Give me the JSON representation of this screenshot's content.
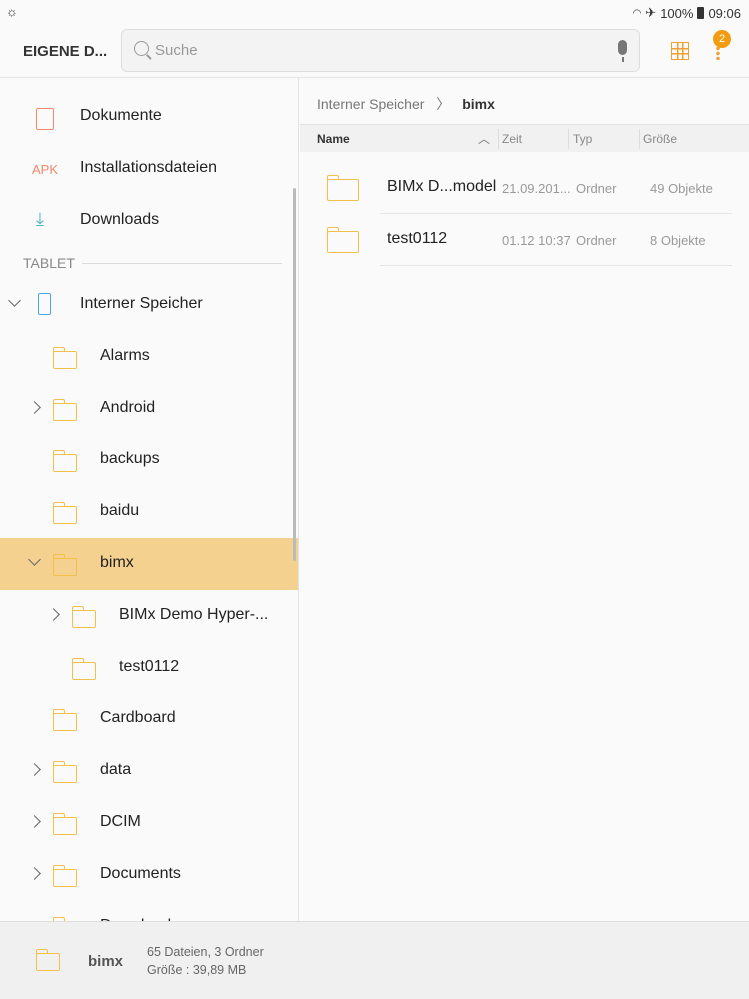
{
  "status": {
    "left_icon": "sync-icon",
    "battery": "100%",
    "time": "09:06",
    "icons": [
      "wifi-icon",
      "airplane-icon",
      "battery-icon"
    ]
  },
  "appbar": {
    "title": "EIGENE D...",
    "search_placeholder": "Suche",
    "badge": "2"
  },
  "sidebar": {
    "top": [
      {
        "icon": "document-icon",
        "label": "Dokumente"
      },
      {
        "icon": "apk-icon",
        "icon_text": "APK",
        "label": "Installationsdateien"
      },
      {
        "icon": "download-icon",
        "label": "Downloads"
      }
    ],
    "section": "TABLET",
    "tree": [
      {
        "label": "Interner Speicher",
        "level": 0,
        "chev": "down",
        "icon": "phone"
      },
      {
        "label": "Alarms",
        "level": 1
      },
      {
        "label": "Android",
        "level": 1,
        "chev": "right"
      },
      {
        "label": "backups",
        "level": 1
      },
      {
        "label": "baidu",
        "level": 1
      },
      {
        "label": "bimx",
        "level": 1,
        "chev": "down",
        "selected": true
      },
      {
        "label": "BIMx Demo Hyper-...",
        "level": 2,
        "chev": "right"
      },
      {
        "label": "test0112",
        "level": 2
      },
      {
        "label": "Cardboard",
        "level": 1
      },
      {
        "label": "data",
        "level": 1,
        "chev": "right"
      },
      {
        "label": "DCIM",
        "level": 1,
        "chev": "right"
      },
      {
        "label": "Documents",
        "level": 1,
        "chev": "right"
      },
      {
        "label": "Download",
        "level": 1
      }
    ]
  },
  "main": {
    "breadcrumb": [
      "Interner Speicher",
      "bimx"
    ],
    "columns": [
      "Name",
      "Zeit",
      "Typ",
      "Größe"
    ],
    "files": [
      {
        "name": "BIMx D...model",
        "time": "21.09.201...",
        "type": "Ordner",
        "size": "49 Objekte"
      },
      {
        "name": "test0112",
        "time": "01.12 10:37",
        "type": "Ordner",
        "size": "8 Objekte"
      }
    ]
  },
  "footer": {
    "name": "bimx",
    "line1": "65 Dateien, 3 Ordner",
    "line2": "Größe : 39,89 MB"
  },
  "colors": {
    "accent": "#f0a030",
    "selected": "#f5d190"
  }
}
